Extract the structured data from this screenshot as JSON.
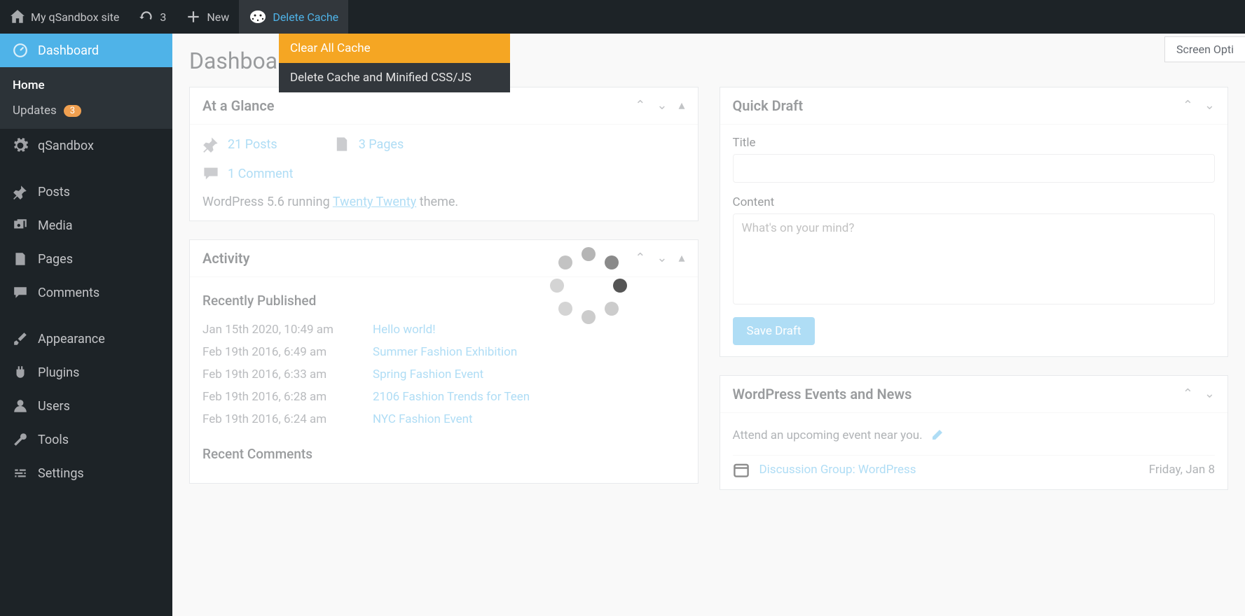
{
  "adminBar": {
    "siteName": "My qSandbox site",
    "updatesCount": "3",
    "newLabel": "New",
    "deleteCacheLabel": "Delete Cache"
  },
  "dropdown": {
    "clearAll": "Clear All Cache",
    "deleteMinified": "Delete Cache and Minified CSS/JS"
  },
  "screenOptions": "Screen Opti",
  "sidebar": {
    "dashboard": "Dashboard",
    "home": "Home",
    "updates": "Updates",
    "updatesBadge": "3",
    "qsandbox": "qSandbox",
    "posts": "Posts",
    "media": "Media",
    "pages": "Pages",
    "comments": "Comments",
    "appearance": "Appearance",
    "plugins": "Plugins",
    "users": "Users",
    "tools": "Tools",
    "settings": "Settings"
  },
  "page": {
    "title": "Dashboard"
  },
  "glance": {
    "title": "At a Glance",
    "posts": "21 Posts",
    "pages": "3 Pages",
    "comments": "1 Comment",
    "footPrefix": "WordPress 5.6 running ",
    "theme": "Twenty Twenty",
    "footSuffix": " theme."
  },
  "activity": {
    "title": "Activity",
    "recentlyPublished": "Recently Published",
    "rows": [
      {
        "date": "Jan 15th 2020, 10:49 am",
        "title": "Hello world!"
      },
      {
        "date": "Feb 19th 2016, 6:49 am",
        "title": "Summer Fashion Exhibition"
      },
      {
        "date": "Feb 19th 2016, 6:33 am",
        "title": "Spring Fashion Event"
      },
      {
        "date": "Feb 19th 2016, 6:28 am",
        "title": "2106 Fashion Trends for Teen"
      },
      {
        "date": "Feb 19th 2016, 6:24 am",
        "title": "NYC Fashion Event"
      }
    ],
    "recentComments": "Recent Comments"
  },
  "quickDraft": {
    "title": "Quick Draft",
    "titleLabel": "Title",
    "contentLabel": "Content",
    "placeholder": "What's on your mind?",
    "save": "Save Draft"
  },
  "events": {
    "title": "WordPress Events and News",
    "intro": "Attend an upcoming event near you.",
    "item": {
      "title": "Discussion Group: WordPress",
      "date": "Friday, Jan 8"
    }
  }
}
